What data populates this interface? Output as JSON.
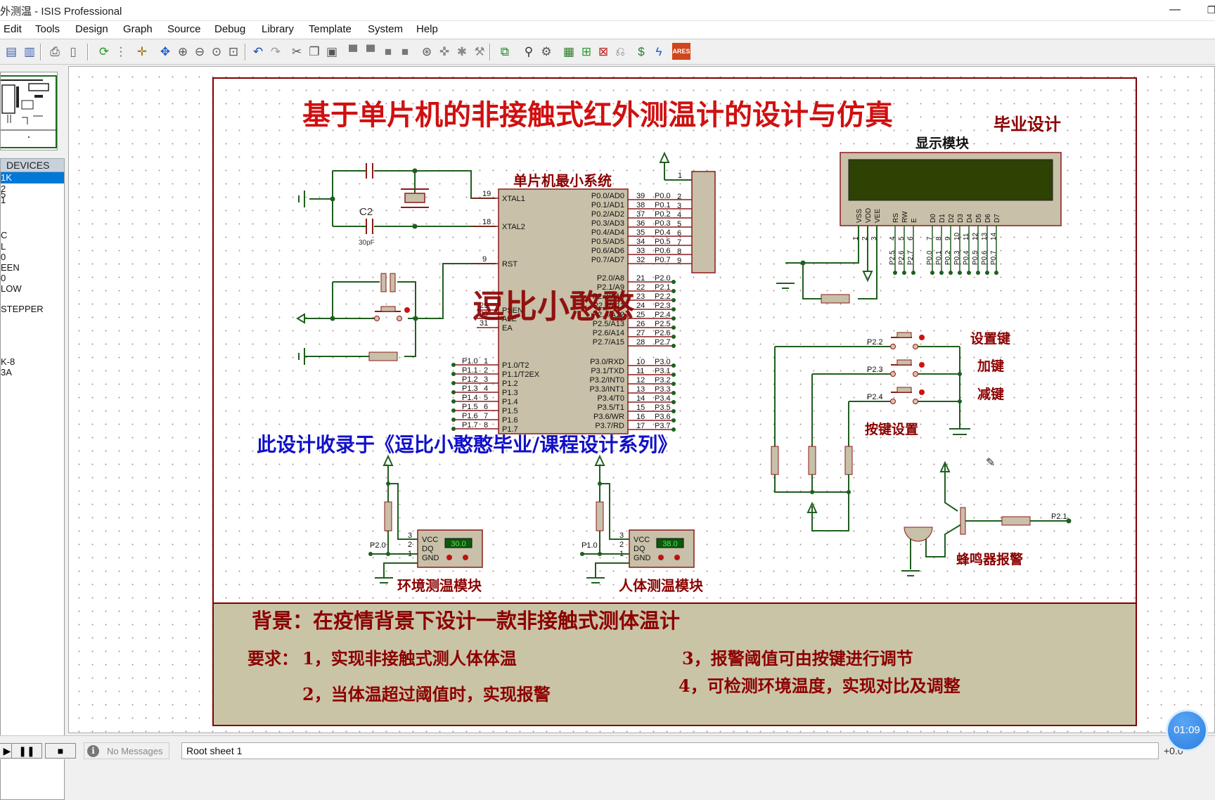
{
  "window": {
    "title": "外测温 - ISIS Professional",
    "minimize_glyph": "—",
    "maximize_glyph": "❐"
  },
  "menu": [
    "Edit",
    "Tools",
    "Design",
    "Graph",
    "Source",
    "Debug",
    "Library",
    "Template",
    "System",
    "Help"
  ],
  "toolbar": {
    "icons": [
      "import-section-icon",
      "export-section-icon",
      "print-icon",
      "page-setup-icon",
      "refresh-icon",
      "grid-toggle-icon",
      "origin-icon",
      "pan-icon",
      "zoom-in-icon",
      "zoom-out-icon",
      "zoom-all-icon",
      "zoom-area-icon",
      "undo-icon",
      "redo-icon",
      "cut-icon",
      "copy-icon",
      "paste-icon",
      "block-copy-icon",
      "block-move-icon",
      "block-rotate-icon",
      "block-delete-icon",
      "pick-device-icon",
      "make-device-icon",
      "package-tool-icon",
      "decompose-icon",
      "wire-autorouter-icon",
      "search-tag-icon",
      "property-assignment-icon",
      "design-explorer-icon",
      "new-sheet-icon",
      "remove-sheet-icon",
      "exit-to-parent-icon",
      "bill-of-materials-icon",
      "electrical-rules-check-icon",
      "ares-netlist-icon"
    ],
    "ares_label": "ARES"
  },
  "devices": {
    "header": "DEVICES",
    "items": [
      "1K",
      "2",
      "5",
      "1",
      "",
      "",
      "C",
      "L",
      "0",
      "EEN",
      "0",
      "LOW",
      "",
      "STEPPER",
      "",
      "",
      "",
      "",
      "K-8",
      "3A"
    ],
    "selected_index": 0
  },
  "schematic": {
    "title": "基于单片机的非接触式红外测温计的设计与仿真",
    "subtitle": "毕业设计",
    "watermark": "逗比小憨憨",
    "series_note": "此设计收录于《逗比小憨憨毕业/课程设计系列》",
    "labels": {
      "mcu": "单片机最小系统",
      "display": "显示模块",
      "keys": "按键设置",
      "key_set": "设置键",
      "key_add": "加键",
      "key_sub": "减键",
      "buzzer": "蜂鸣器报警",
      "env_sensor": "环境测温模块",
      "body_sensor": "人体测温模块"
    },
    "cap_label": "C2",
    "cap_value": "30pF",
    "mcu_left_pins": [
      {
        "num": "19",
        "name": "XTAL1"
      },
      {
        "num": "18",
        "name": "XTAL2"
      },
      {
        "num": "9",
        "name": "RST"
      },
      {
        "num": "29",
        "name": "PSEN"
      },
      {
        "num": "30",
        "name": "ALE"
      },
      {
        "num": "31",
        "name": "EA"
      }
    ],
    "mcu_p1_pins": [
      {
        "num": "1",
        "net": "P1.0",
        "name": "P1.0/T2"
      },
      {
        "num": "2",
        "net": "P1.1",
        "name": "P1.1/T2EX"
      },
      {
        "num": "3",
        "net": "P1.2",
        "name": "P1.2"
      },
      {
        "num": "4",
        "net": "P1.3",
        "name": "P1.3"
      },
      {
        "num": "5",
        "net": "P1.4",
        "name": "P1.4"
      },
      {
        "num": "6",
        "net": "P1.5",
        "name": "P1.5"
      },
      {
        "num": "7",
        "net": "P1.6",
        "name": "P1.6"
      },
      {
        "num": "8",
        "net": "P1.7",
        "name": "P1.7"
      }
    ],
    "mcu_p0_pins": [
      {
        "num": "39",
        "net": "P0.0",
        "rp": "2",
        "name": "P0.0/AD0"
      },
      {
        "num": "38",
        "net": "P0.1",
        "rp": "3",
        "name": "P0.1/AD1"
      },
      {
        "num": "37",
        "net": "P0.2",
        "rp": "4",
        "name": "P0.2/AD2"
      },
      {
        "num": "36",
        "net": "P0.3",
        "rp": "5",
        "name": "P0.3/AD3"
      },
      {
        "num": "35",
        "net": "P0.4",
        "rp": "6",
        "name": "P0.4/AD4"
      },
      {
        "num": "34",
        "net": "P0.5",
        "rp": "7",
        "name": "P0.5/AD5"
      },
      {
        "num": "33",
        "net": "P0.6",
        "rp": "8",
        "name": "P0.6/AD6"
      },
      {
        "num": "32",
        "net": "P0.7",
        "rp": "9",
        "name": "P0.7/AD7"
      }
    ],
    "rp_common_pin": "1",
    "mcu_p2_pins": [
      {
        "num": "21",
        "net": "P2.0",
        "name": "P2.0/A8"
      },
      {
        "num": "22",
        "net": "P2.1",
        "name": "P2.1/A9"
      },
      {
        "num": "23",
        "net": "P2.2",
        "name": "P2.2/A10"
      },
      {
        "num": "24",
        "net": "P2.3",
        "name": "P2.3/A11"
      },
      {
        "num": "25",
        "net": "P2.4",
        "name": "P2.4/A12"
      },
      {
        "num": "26",
        "net": "P2.5",
        "name": "P2.5/A13"
      },
      {
        "num": "27",
        "net": "P2.6",
        "name": "P2.6/A14"
      },
      {
        "num": "28",
        "net": "P2.7",
        "name": "P2.7/A15"
      }
    ],
    "mcu_p3_pins": [
      {
        "num": "10",
        "net": "P3.0",
        "name": "P3.0/RXD"
      },
      {
        "num": "11",
        "net": "P3.1",
        "name": "P3.1/TXD"
      },
      {
        "num": "12",
        "net": "P3.2",
        "name": "P3.2/INT0"
      },
      {
        "num": "13",
        "net": "P3.3",
        "name": "P3.3/INT1"
      },
      {
        "num": "14",
        "net": "P3.4",
        "name": "P3.4/T0"
      },
      {
        "num": "15",
        "net": "P3.5",
        "name": "P3.5/T1"
      },
      {
        "num": "16",
        "net": "P3.6",
        "name": "P3.6/WR"
      },
      {
        "num": "17",
        "net": "P3.7",
        "name": "P3.7/RD"
      }
    ],
    "lcd_pins": [
      {
        "name": "VSS",
        "num": "1",
        "net": ""
      },
      {
        "name": "VDD",
        "num": "2",
        "net": ""
      },
      {
        "name": "VEE",
        "num": "3",
        "net": ""
      },
      {
        "name": "RS",
        "num": "4",
        "net": "P2.5"
      },
      {
        "name": "RW",
        "num": "5",
        "net": "P2.6"
      },
      {
        "name": "E",
        "num": "6",
        "net": "P2.7"
      },
      {
        "name": "D0",
        "num": "7",
        "net": "P0.0"
      },
      {
        "name": "D1",
        "num": "8",
        "net": "P0.1"
      },
      {
        "name": "D2",
        "num": "9",
        "net": "P0.2"
      },
      {
        "name": "D3",
        "num": "10",
        "net": "P0.3"
      },
      {
        "name": "D4",
        "num": "11",
        "net": "P0.4"
      },
      {
        "name": "D5",
        "num": "12",
        "net": "P0.5"
      },
      {
        "name": "D6",
        "num": "13",
        "net": "P0.6"
      },
      {
        "name": "D7",
        "num": "14",
        "net": "P0.7"
      }
    ],
    "key_nets": [
      "P2.2",
      "P2.3",
      "P2.4"
    ],
    "buzzer_net": "P2.1",
    "sensor_env": {
      "net": "P2.0",
      "reading": "30.0",
      "pins": [
        "VCC",
        "DQ",
        "GND"
      ],
      "pin_nums": [
        "3",
        "2",
        "1"
      ]
    },
    "sensor_body": {
      "net": "P1.0",
      "reading": "38.0",
      "pins": [
        "VCC",
        "DQ",
        "GND"
      ],
      "pin_nums": [
        "3",
        "2",
        "1"
      ]
    },
    "background_line": "背景：在疫情背景下设计一款非接触式测体温计",
    "req_label": "要求：",
    "requirements": [
      "1，实现非接触式测人体体温",
      "2，当体温超过阈值时，实现报警",
      "3，报警阈值可由按键进行调节",
      "4，可检测环境温度，实现对比及调整"
    ]
  },
  "status": {
    "messages": "No Messages",
    "sheet": "Root sheet 1",
    "coord": "+0.0",
    "info_glyph": "i",
    "play_glyph": "▶",
    "pause_glyph": "❚❚",
    "stop_glyph": "■"
  },
  "overlay": {
    "timer": "01:09"
  },
  "colors": {
    "title_red": "#d01010",
    "label_dark_red": "#8b0000",
    "note_blue": "#1010c8",
    "wire_green": "#1f5f1f",
    "pin_red": "#8b1a1a",
    "component_fill": "#c8c0a8",
    "lcd_screen": "#2e4204",
    "note_box": "#cac4a6"
  }
}
